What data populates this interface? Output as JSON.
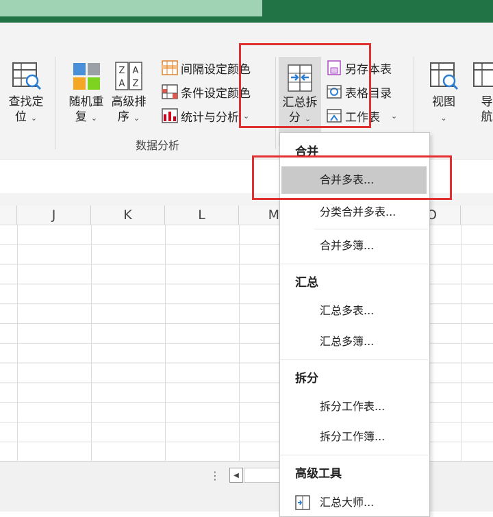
{
  "ribbon": {
    "find_locate": {
      "line1": "查找定",
      "line2": "位"
    },
    "random_reorder": {
      "line1": "随机重",
      "line2": "复"
    },
    "advanced_sort": {
      "line1": "高级排",
      "line2": "序"
    },
    "interval_color": "间隔设定颜色",
    "condition_color": "条件设定颜色",
    "stats_analysis": "统计与分析",
    "summary_split": {
      "line1": "汇总拆",
      "line2": "分"
    },
    "save_sheet_as": "另存本表",
    "table_directory": "表格目录",
    "worksheet": "工作表",
    "view": {
      "line1": "视图"
    },
    "navigation": {
      "line1": "导",
      "line2": "航"
    },
    "group_label": "数据分析",
    "chevron": "⌄"
  },
  "grid": {
    "columns": [
      "J",
      "K",
      "L",
      "M",
      "O"
    ]
  },
  "menu": {
    "section_merge": "合并",
    "merge_multi_sheets": "合并多表...",
    "classify_merge_sheets": "分类合并多表...",
    "merge_multi_books": "合并多簿...",
    "section_summary": "汇总",
    "summary_multi_sheets": "汇总多表...",
    "summary_multi_books": "汇总多簿...",
    "section_split": "拆分",
    "split_worksheet": "拆分工作表...",
    "split_workbook": "拆分工作簿...",
    "section_advanced": "高级工具",
    "summary_master": "汇总大师..."
  },
  "sheetbar": {
    "dots": "⋮",
    "scroll_left": "◀"
  },
  "colors": {
    "accent_green": "#217346",
    "highlight_red": "#e0302f",
    "selected_gray": "#c9c9c9"
  }
}
